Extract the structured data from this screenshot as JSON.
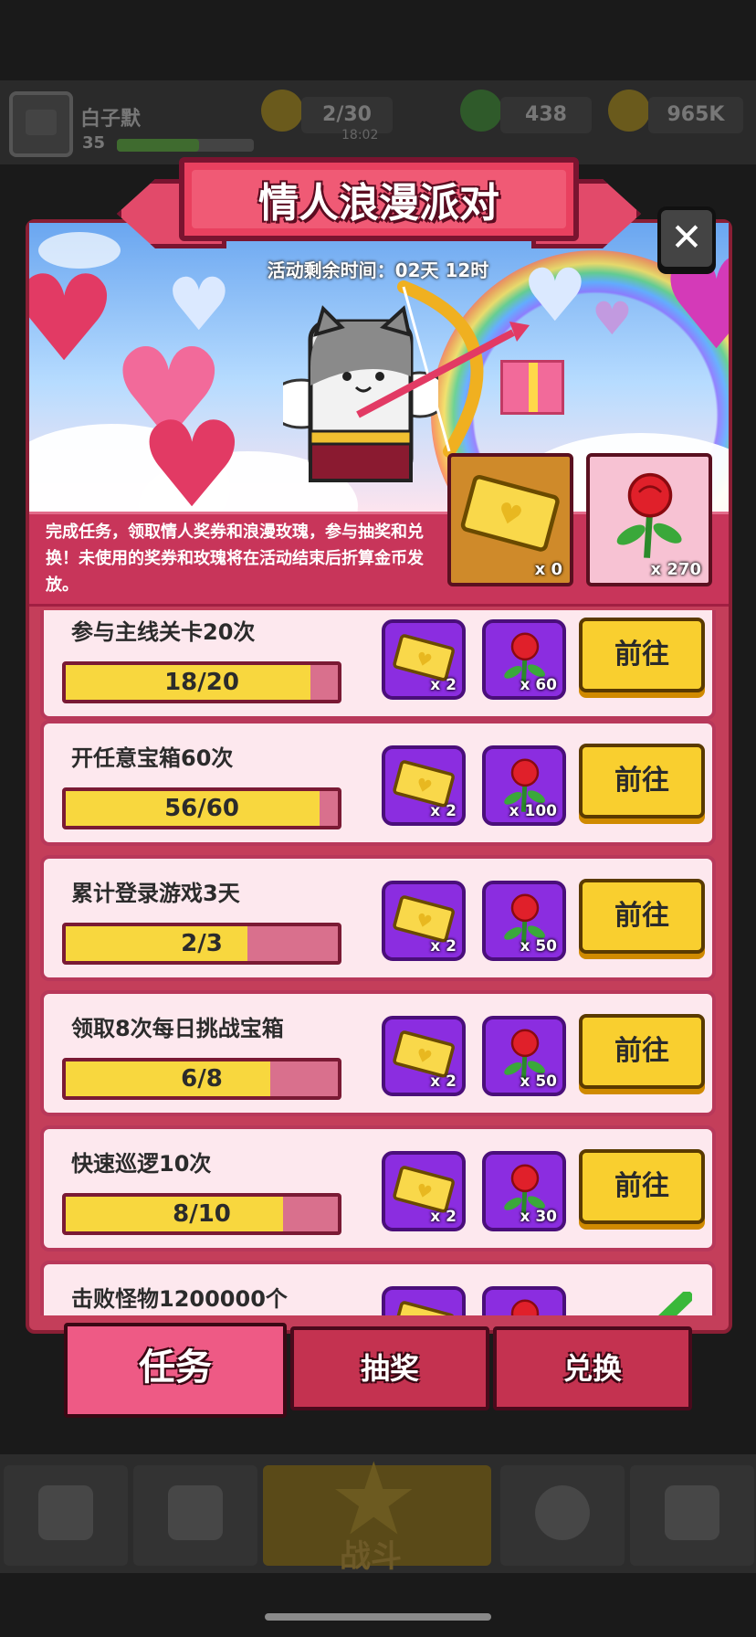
{
  "player": {
    "name": "白子默",
    "level": "35"
  },
  "resources": {
    "energy": "2/30",
    "energy_timer": "18:02",
    "gems": "438",
    "coins": "965K"
  },
  "event": {
    "title": "情人浪漫派对",
    "timer": "活动剩余时间：02天 12时",
    "description": "完成任务，领取情人奖券和浪漫玫瑰，参与抽奖和兑换！未使用的奖券和玫瑰将在活动结束后折算金币发放。",
    "ticket_count": "x 0",
    "rose_count": "x 270"
  },
  "tasks": [
    {
      "name": "参与主线关卡20次",
      "progress_text": "18/20",
      "progress": 0.9,
      "ticket_reward": "x 2",
      "rose_reward": "x 60",
      "button": "前往"
    },
    {
      "name": "开任意宝箱60次",
      "progress_text": "56/60",
      "progress": 0.933,
      "ticket_reward": "x 2",
      "rose_reward": "x 100",
      "button": "前往"
    },
    {
      "name": "累计登录游戏3天",
      "progress_text": "2/3",
      "progress": 0.667,
      "ticket_reward": "x 2",
      "rose_reward": "x 50",
      "button": "前往"
    },
    {
      "name": "领取8次每日挑战宝箱",
      "progress_text": "6/8",
      "progress": 0.75,
      "ticket_reward": "x 2",
      "rose_reward": "x 50",
      "button": "前往"
    },
    {
      "name": "快速巡逻10次",
      "progress_text": "8/10",
      "progress": 0.8,
      "ticket_reward": "x 2",
      "rose_reward": "x 30",
      "button": "前往"
    },
    {
      "name": "击败怪物1200000个"
    }
  ],
  "tabs": [
    "任务",
    "抽奖",
    "兑换"
  ],
  "nav": {
    "battle": "战斗"
  },
  "colors": {
    "accent": "#e9405f",
    "progress_fill": "#f8d73e",
    "button": "#f9cf2f",
    "reward_bg": "#8b2de0"
  }
}
